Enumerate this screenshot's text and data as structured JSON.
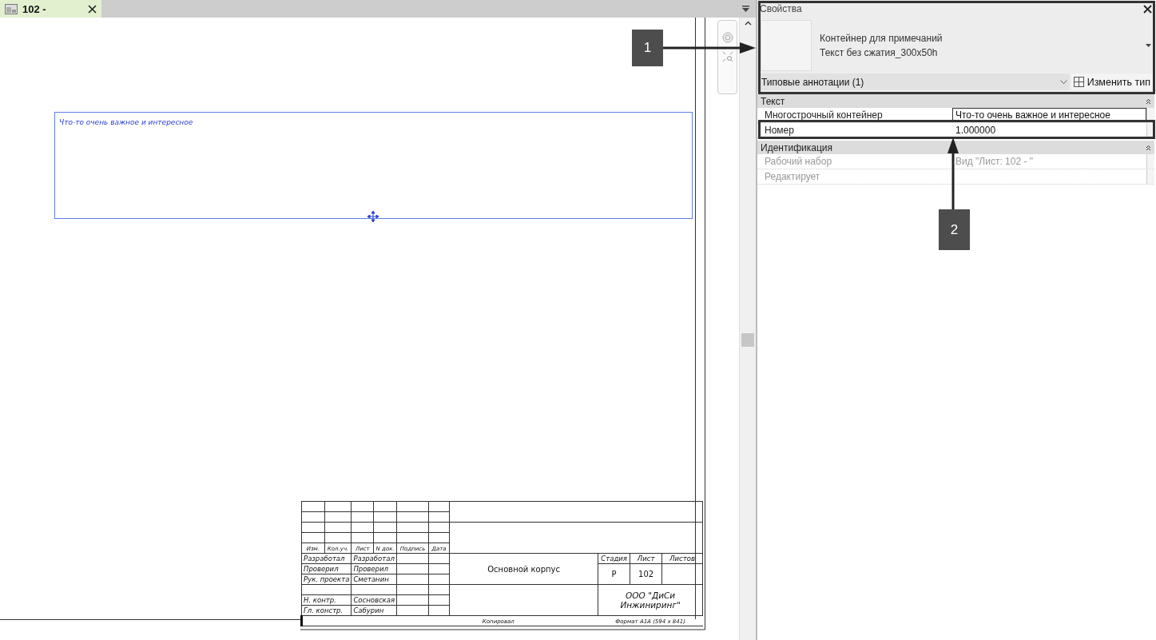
{
  "tab": {
    "title": "102 -",
    "selected": true
  },
  "canvas": {
    "note_text": "Что-то очень важное и интересное",
    "title_block": {
      "revision_headers": [
        "Изм.",
        "Кол.уч.",
        "Лист",
        "N док.",
        "Подпись",
        "Дата"
      ],
      "signatures": [
        {
          "role": "Разработал",
          "name": "Разработал"
        },
        {
          "role": "Проверил",
          "name": "Проверил"
        },
        {
          "role": "Рук. проекта",
          "name": "Сметанин"
        },
        {
          "role": "Н. контр.",
          "name": "Сосновская"
        },
        {
          "role": "Гл. констр.",
          "name": "Сабурин"
        }
      ],
      "building": "Основной корпус",
      "stage_headers": [
        "Стадия",
        "Лист",
        "Листов"
      ],
      "stage_values": [
        "Р",
        "102"
      ],
      "company": "ООО \"ДиСи Инжиниринг\"",
      "copied": "Копировал",
      "format": "Формат А1А (594 x 841)"
    }
  },
  "properties": {
    "title": "Свойства",
    "type_family": "Контейнер для примечаний",
    "type_name": "Текст без сжатия_300x50h",
    "filter": "Типовые аннотации (1)",
    "edit_type": "Изменить тип",
    "groups": [
      {
        "name": "Текст",
        "expanded": true,
        "rows": [
          {
            "label": "Многострочный контейнер",
            "value": "Что-то очень важное и интересное",
            "disabled": false,
            "editing": true
          },
          {
            "label": "Номер",
            "value": "1.000000",
            "disabled": false,
            "editing": false
          }
        ]
      },
      {
        "name": "Идентификация",
        "expanded": true,
        "rows": [
          {
            "label": "Рабочий набор",
            "value": "Вид \"Лист: 102 - \"",
            "disabled": true,
            "editing": false
          },
          {
            "label": "Редактирует",
            "disabled": true,
            "editing": false
          }
        ]
      }
    ]
  },
  "callouts": [
    {
      "label": "1"
    },
    {
      "label": "2"
    }
  ]
}
